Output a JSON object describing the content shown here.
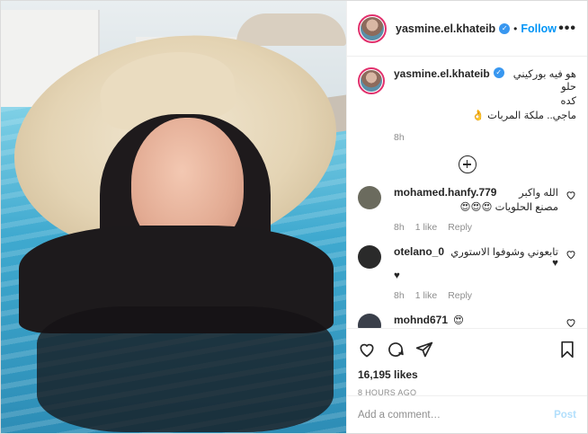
{
  "post": {
    "username": "yasmine.el.khateib",
    "follow_label": "Follow",
    "dot": "•",
    "more_label": "•••"
  },
  "caption": {
    "username": "yasmine.el.khateib",
    "text_line1": "هو فيه بوركيني حلو",
    "text_line2": "كده",
    "text_line3": "ماجي.. ملكة المربات 👌",
    "time": "8h"
  },
  "comments": [
    {
      "username": "mohamed.hanfy.779",
      "text": "الله واكبر",
      "text2": "مصنع الحلويات 😍😍😍",
      "time": "8h",
      "likes": "1 like",
      "reply": "Reply",
      "avatar_color": "#6b6b5e"
    },
    {
      "username": "otelano_0",
      "text": "تابعوني وشوفوا الاستوري ♥",
      "text2": "♥",
      "time": "8h",
      "likes": "1 like",
      "reply": "Reply",
      "avatar_color": "#2a2a2a"
    },
    {
      "username": "mohnd671",
      "text": "😍",
      "text2": "",
      "time": "",
      "likes": "",
      "reply": "",
      "avatar_color": "#3a3f4a"
    }
  ],
  "actions": {
    "likes": "16,195 likes",
    "ago": "8 HOURS AGO"
  },
  "add_comment": {
    "placeholder": "Add a comment…",
    "post_label": "Post"
  },
  "colors": {
    "accent": "#0095f6",
    "verified": "#3897f0",
    "story_ring": "#e1306c"
  }
}
